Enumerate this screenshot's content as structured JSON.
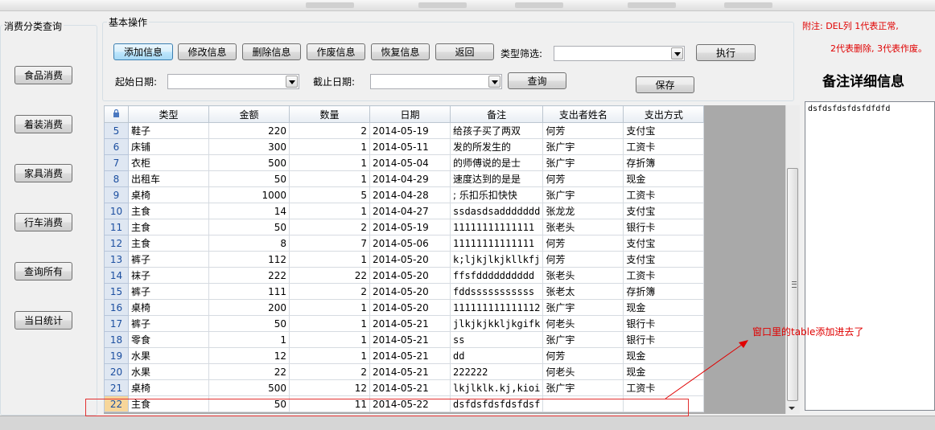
{
  "left_group": {
    "title": "消费分类查询",
    "buttons": [
      "食品消费",
      "着装消费",
      "家具消费",
      "行车消费",
      "查询所有",
      "当日统计"
    ]
  },
  "ops_group": {
    "title": "基本操作",
    "buttons": {
      "add": "添加信息",
      "edit": "修改信息",
      "delete": "删除信息",
      "void": "作废信息",
      "restore": "恢复信息",
      "back": "返回",
      "execute": "执行",
      "query": "查询",
      "save": "保存"
    },
    "type_filter_label": "类型筛选:",
    "type_filter_value": "",
    "start_date_label": "起始日期:",
    "start_date_value": "",
    "end_date_label": "截止日期:",
    "end_date_value": ""
  },
  "notes": {
    "line1": "附注: DEL列   1代表正常,",
    "line2": "2代表删除, 3代表作废。"
  },
  "detail": {
    "title": "备注详细信息",
    "text": "dsfdsfdsfdsfdfdfd"
  },
  "grid": {
    "columns": [
      "类型",
      "金额",
      "数量",
      "日期",
      "备注",
      "支出者姓名",
      "支出方式"
    ],
    "rows": [
      {
        "n": "5",
        "cells": [
          "鞋子",
          "220",
          "2",
          "2014-05-19",
          "给孩子买了两双",
          "何芳",
          "支付宝"
        ]
      },
      {
        "n": "6",
        "cells": [
          "床铺",
          "300",
          "1",
          "2014-05-11",
          "发的所发生的",
          "张广宇",
          "工资卡"
        ]
      },
      {
        "n": "7",
        "cells": [
          "衣柜",
          "500",
          "1",
          "2014-05-04",
          "的师傅说的是士",
          "张广宇",
          "存折簿"
        ]
      },
      {
        "n": "8",
        "cells": [
          "出租车",
          "50",
          "1",
          "2014-04-29",
          "速度达到的是是",
          "何芳",
          "现金"
        ]
      },
      {
        "n": "9",
        "cells": [
          "桌椅",
          "1000",
          "5",
          "2014-04-28",
          "; 乐扣乐扣快快",
          "张广宇",
          "工资卡"
        ]
      },
      {
        "n": "10",
        "cells": [
          "主食",
          "14",
          "1",
          "2014-04-27",
          "ssdasdsaddddddd",
          "张龙龙",
          "支付宝"
        ]
      },
      {
        "n": "11",
        "cells": [
          "主食",
          "50",
          "2",
          "2014-05-19",
          "11111111111111",
          "张老头",
          "银行卡"
        ]
      },
      {
        "n": "12",
        "cells": [
          "主食",
          "8",
          "7",
          "2014-05-06",
          "11111111111111",
          "何芳",
          "支付宝"
        ]
      },
      {
        "n": "13",
        "cells": [
          "裤子",
          "112",
          "1",
          "2014-05-20",
          "k;ljkjlkjkllkfj",
          "何芳",
          "支付宝"
        ]
      },
      {
        "n": "14",
        "cells": [
          "袜子",
          "222",
          "22",
          "2014-05-20",
          "ffsfdddddddddd",
          "张老头",
          "工资卡"
        ]
      },
      {
        "n": "15",
        "cells": [
          "裤子",
          "111",
          "2",
          "2014-05-20",
          "fddsssssssssss",
          "张老太",
          "存折簿"
        ]
      },
      {
        "n": "16",
        "cells": [
          "桌椅",
          "200",
          "1",
          "2014-05-20",
          "111111111111112",
          "张广宇",
          "现金"
        ]
      },
      {
        "n": "17",
        "cells": [
          "裤子",
          "50",
          "1",
          "2014-05-21",
          "jlkjkjkkljkgifk",
          "何老头",
          "银行卡"
        ]
      },
      {
        "n": "18",
        "cells": [
          "零食",
          "1",
          "1",
          "2014-05-21",
          "ss",
          "张广宇",
          "银行卡"
        ]
      },
      {
        "n": "19",
        "cells": [
          "水果",
          "12",
          "1",
          "2014-05-21",
          "dd",
          "何芳",
          "现金"
        ]
      },
      {
        "n": "20",
        "cells": [
          "水果",
          "22",
          "2",
          "2014-05-21",
          "222222",
          "何老头",
          "现金"
        ]
      },
      {
        "n": "21",
        "cells": [
          "桌椅",
          "500",
          "12",
          "2014-05-21",
          "lkjlklk.kj,kioi",
          "张广宇",
          "工资卡"
        ]
      },
      {
        "n": "22",
        "cells": [
          "主食",
          "50",
          "11",
          "2014-05-22",
          "dsfdsfdsfdsfdsf",
          "",
          ""
        ]
      }
    ]
  },
  "annotation": "窗口里的table添加进去了",
  "colors": {
    "annotation": "#e00000",
    "row_highlight": "#f7d69a",
    "row_header": "#dfe7f2"
  }
}
